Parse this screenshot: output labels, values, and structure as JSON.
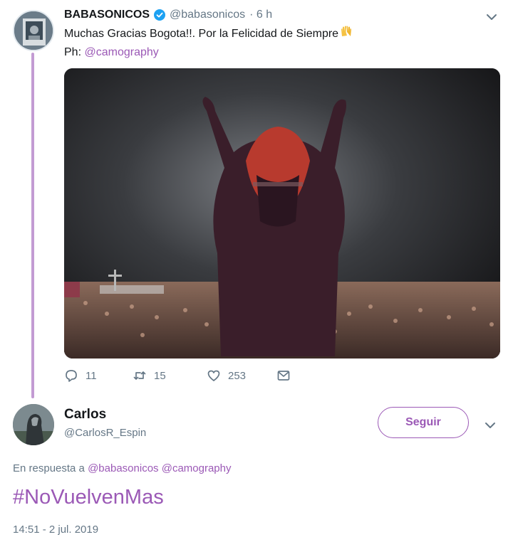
{
  "tweet": {
    "author_name": "BABASONICOS",
    "author_handle": "@babasonicos",
    "time": "· 6 h",
    "text": "Muchas Gracias Bogota!!. Por la Felicidad de Siempre",
    "credit_prefix": "Ph:",
    "credit_mention": "@camography",
    "icons": [
      "verified-badge-icon",
      "chevron-down-icon",
      "raising-hands-icon"
    ],
    "actions": {
      "replies": "11",
      "retweets": "15",
      "likes": "253"
    },
    "accent_color": "#9b59b6"
  },
  "reply": {
    "author_name": "Carlos",
    "author_handle": "@CarlosR_Espin",
    "follow_label": "Seguir",
    "reply_prefix": "En respuesta a",
    "reply_mention_1": "@babasonicos",
    "reply_mention_2": "@camography",
    "text": "#NoVuelvenMas",
    "timestamp": "14:51 - 2 jul. 2019"
  }
}
